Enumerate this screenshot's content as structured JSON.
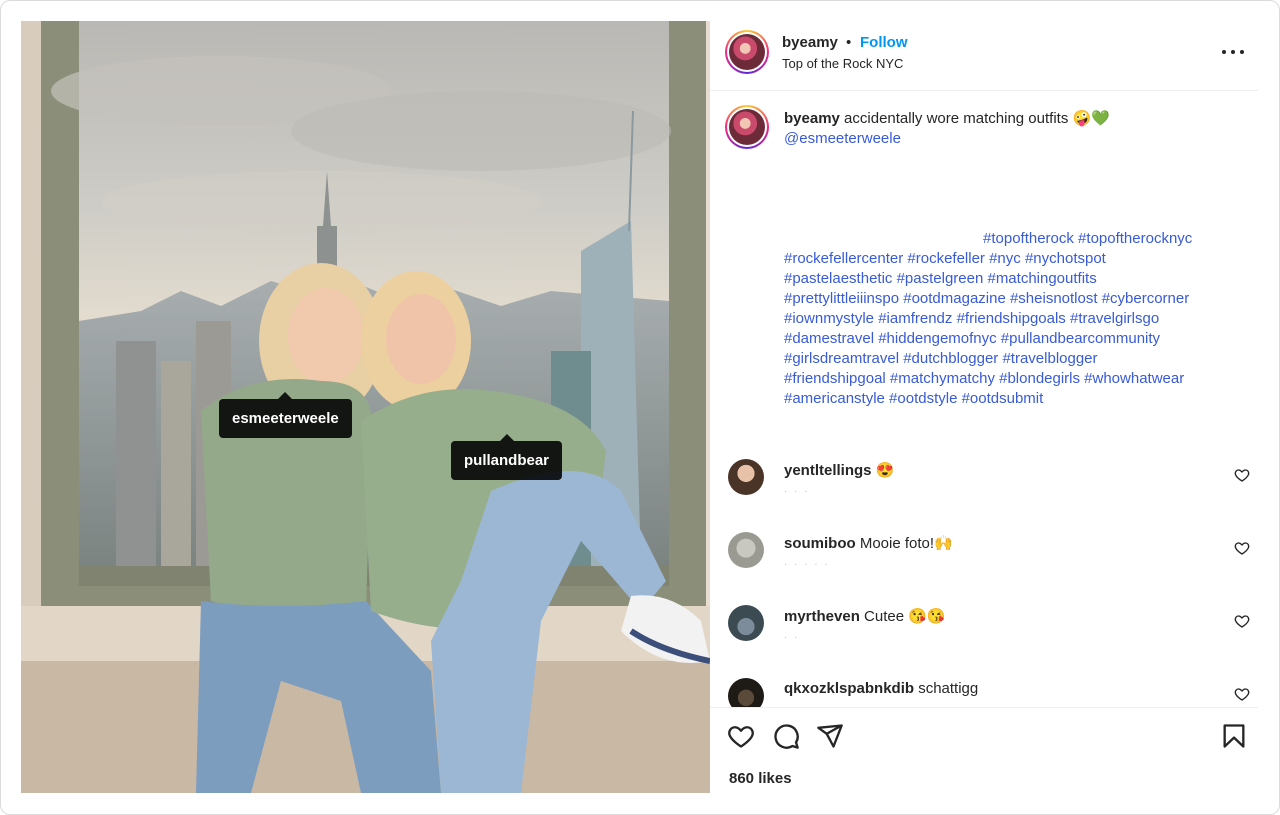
{
  "post": {
    "username": "byeamy",
    "separator": "•",
    "follow_label": "Follow",
    "location": "Top of the Rock NYC",
    "more_icon": "more-horizontal-icon"
  },
  "photo": {
    "tags": [
      "esmeeterweele",
      "pullandbear"
    ]
  },
  "caption": {
    "username": "byeamy",
    "text": "accidentally wore matching outfits 🤪💚",
    "mention": "@esmeeterweele",
    "hashtag_lines": [
      "#topoftherock #topoftherocknyc",
      "#rockefellercenter #rockefeller #nyc #nychotspot",
      "#pastelaesthetic #pastelgreen #matchingoutfits",
      "#prettylittleiiinspo #ootdmagazine #sheisnotlost #cybercorner",
      "#iownmystyle #iamfrendz #friendshipgoals #travelgirlsgo",
      "#damestravel #hiddengemofnyc #pullandbearcommunity",
      "#girlsdreamtravel #dutchblogger #travelblogger",
      "#friendshipgoal #matchymatchy #blondegirls #whowhatwear",
      "#americanstyle #ootdstyle #ootdsubmit"
    ]
  },
  "comments": [
    {
      "username": "yentltellings",
      "text": "😍",
      "meta": ". . ."
    },
    {
      "username": "soumiboo",
      "text": "Mooie foto!🙌",
      "meta": ". . . . ."
    },
    {
      "username": "myrtheven",
      "text": "Cutee 😘😘",
      "meta": ". ."
    },
    {
      "username": "qkxozklspabnkdib",
      "text": "schattigg",
      "meta": ""
    }
  ],
  "actions": {
    "icons": [
      "heart-icon",
      "comment-icon",
      "share-icon",
      "bookmark-icon"
    ],
    "likes": "860 likes"
  },
  "colors": {
    "link": "#385bd6",
    "follow": "#0095f6",
    "text": "#262626"
  }
}
